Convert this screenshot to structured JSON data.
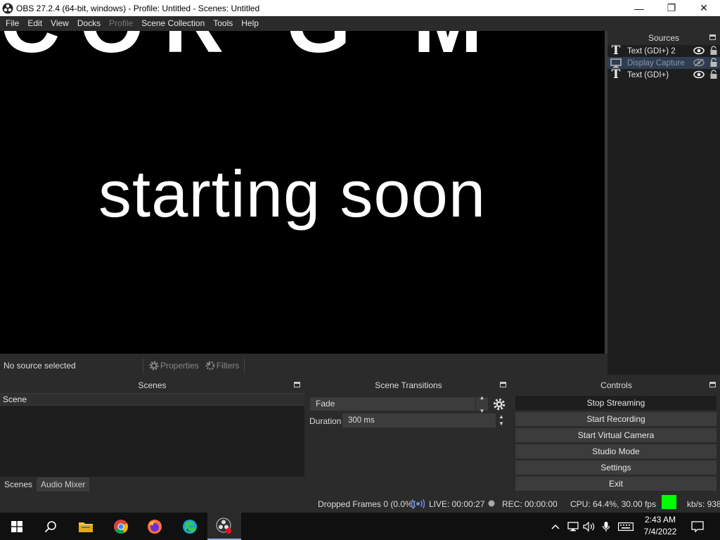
{
  "window": {
    "title": "OBS 27.2.4 (64-bit, windows) - Profile: Untitled - Scenes: Untitled",
    "minimize": "—",
    "maximize": "❐",
    "close": "✕"
  },
  "menu": [
    "File",
    "Edit",
    "View",
    "Docks",
    "Profile",
    "Scene Collection",
    "Tools",
    "Help"
  ],
  "menu_disabled": [
    "Profile"
  ],
  "preview": {
    "top_text": "COR G M",
    "main_text": "starting soon"
  },
  "sources": {
    "title": "Sources",
    "items": [
      {
        "label": "Text (GDI+) 2",
        "icon": "text-icon",
        "visible": true
      },
      {
        "label": "Display Capture",
        "icon": "monitor-icon",
        "visible": false,
        "selected": true
      },
      {
        "label": "Text (GDI+)",
        "icon": "text-icon",
        "visible": true
      }
    ]
  },
  "source_toolbar": {
    "no_source": "No source selected",
    "properties": "Properties",
    "filters": "Filters"
  },
  "scenes": {
    "title": "Scenes",
    "items": [
      "Scene"
    ],
    "tabs": [
      "Scenes",
      "Audio Mixer"
    ]
  },
  "transitions": {
    "title": "Scene Transitions",
    "selected": "Fade",
    "duration_label": "Duration",
    "duration_value": "300 ms"
  },
  "controls": {
    "title": "Controls",
    "buttons": [
      "Stop Streaming",
      "Start Recording",
      "Start Virtual Camera",
      "Studio Mode",
      "Settings",
      "Exit"
    ]
  },
  "status": {
    "dropped": "Dropped Frames 0 (0.0%)",
    "live": "LIVE: 00:00:27",
    "rec": "REC: 00:00:00",
    "cpu": "CPU: 64.4%, 30.00 fps",
    "kbs": "kb/s: 938",
    "indicator_color": "#00ff00"
  },
  "taskbar": {
    "time": "2:43 AM",
    "date": "7/4/2022",
    "apps": [
      "start-icon",
      "search-icon",
      "file-explorer-icon",
      "chrome-icon",
      "firefox-icon",
      "edge-icon",
      "obs-icon"
    ]
  }
}
